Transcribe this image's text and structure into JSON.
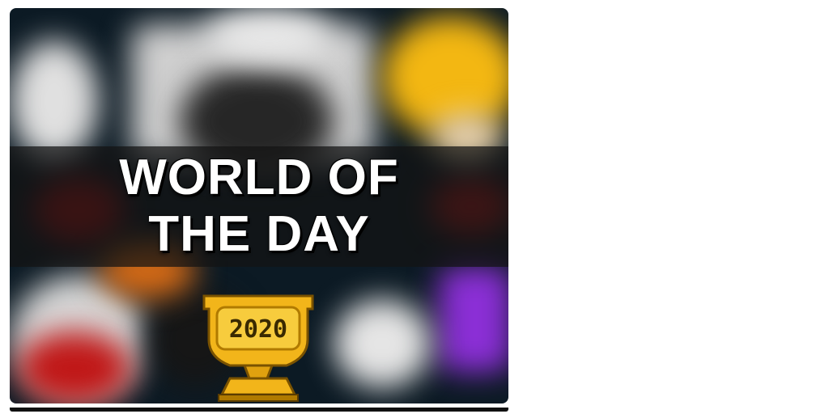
{
  "card": {
    "title_line1": "WORLD OF",
    "title_line2": "THE DAY",
    "year": "2020"
  },
  "colors": {
    "trophy_gold": "#f2b51a",
    "trophy_shadow": "#b07a00",
    "banner": "#141414"
  },
  "icons": {
    "trophy": "trophy-icon"
  }
}
